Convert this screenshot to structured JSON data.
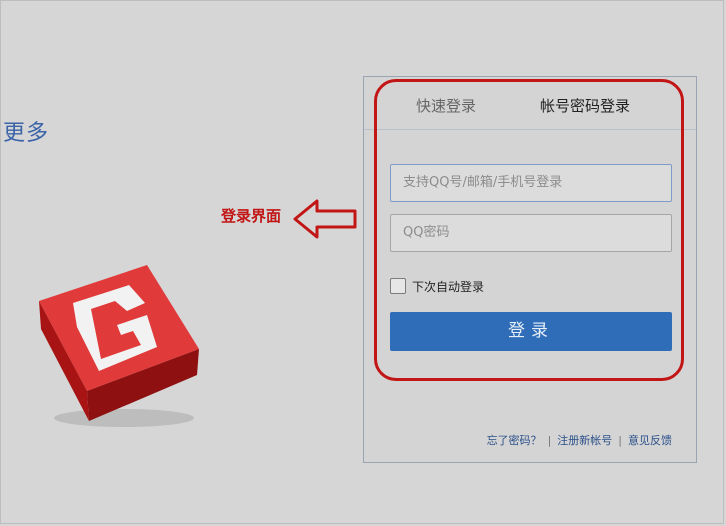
{
  "page": {
    "more_text": "更多"
  },
  "annotation": {
    "label": "登录界面",
    "color": "#c21515"
  },
  "login": {
    "tabs": [
      {
        "label": "快速登录",
        "active": false
      },
      {
        "label": "帐号密码登录",
        "active": true
      }
    ],
    "username_placeholder": "支持QQ号/邮箱/手机号登录",
    "password_placeholder": "QQ密码",
    "remember_label": "下次自动登录",
    "remember_checked": false,
    "submit_label": "登录",
    "footer": {
      "forgot": "忘了密码？",
      "register": "注册新帐号",
      "feedback": "意见反馈",
      "separator": "|"
    }
  },
  "colors": {
    "accent": "#2f6db8",
    "highlight": "#c21515",
    "logo": "#c7191a"
  },
  "icons": {
    "logo": "red-g-cube-logo",
    "arrow": "left-arrow-outline"
  }
}
